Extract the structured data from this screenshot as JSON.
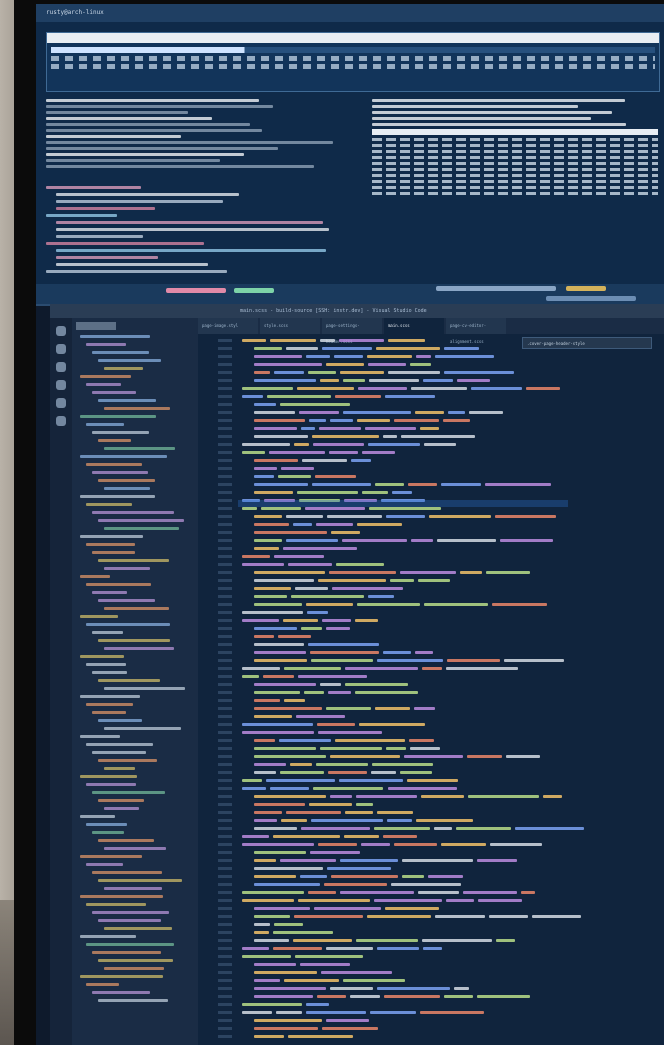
{
  "terminal": {
    "title": "rusty@arch-linux"
  },
  "vscode": {
    "title": "main.scss - build-source [SSH: instr.dev] - Visual Studio Code",
    "tabs": [
      "page-image.styl",
      "style.scss",
      "page-settings-header.scss",
      "main.scss",
      "page-cv-editor-alignment.scss"
    ],
    "active_tab_index": 3,
    "search_text": ".cover-page-header-style",
    "colors": {
      "keyword": "#c792ea",
      "selector": "#ffcb6b",
      "property": "#82aaff",
      "value": "#f78c6c",
      "string": "#c3e88d",
      "plain": "#e0e6ee"
    }
  }
}
